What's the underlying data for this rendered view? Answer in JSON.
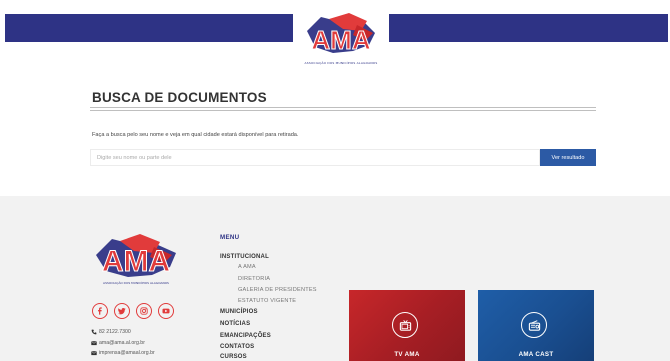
{
  "header": {
    "logo_text": "AMA",
    "logo_subtitle": "ASSOCIAÇÃO DOS MUNICÍPIOS ALAGOANOS"
  },
  "search": {
    "title": "BUSCA DE DOCUMENTOS",
    "description": "Faça a busca pelo seu nome e veja em qual cidade estará disponível para retirada.",
    "placeholder": "Digite seu nome ou parte dele",
    "button_label": "Ver resultado"
  },
  "footer": {
    "logo_text": "AMA",
    "logo_subtitle": "ASSOCIAÇÃO DOS MUNICÍPIOS ALAGOANOS",
    "socials": [
      "facebook-icon",
      "twitter-icon",
      "instagram-icon",
      "youtube-icon"
    ],
    "contacts": {
      "phone": "82 2122.7300",
      "email1": "ama@ama.al.org.br",
      "email2": "imprensa@amaal.org.br"
    },
    "menu": {
      "title": "MENU",
      "institucional": "INSTITUCIONAL",
      "sub": [
        "A AMA",
        "DIRETORIA",
        "GALERIA DE PRESIDENTES",
        "ESTATUTO VIGENTE"
      ],
      "municipios": "MUNICÍPIOS",
      "noticias": "NOTÍCIAS",
      "emancipacoes": "EMANCIPAÇÕES",
      "contatos": "CONTATOS",
      "cursos": "CURSOS"
    },
    "cards": {
      "tv": "TV AMA",
      "cast": "AMA CAST"
    }
  },
  "colors": {
    "navy": "#2e3385",
    "red": "#e13b3b",
    "button_blue": "#2c5aa5",
    "footer_bg": "#f2f2f2"
  }
}
